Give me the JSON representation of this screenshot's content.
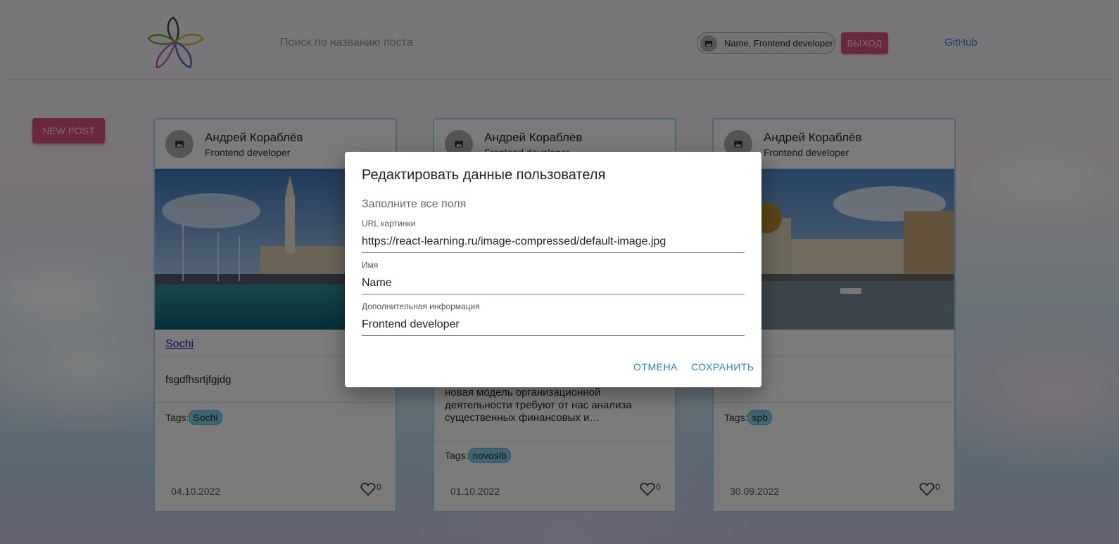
{
  "header": {
    "search_placeholder": "Поиск по названию поста",
    "user_chip": "Name, Frontend developer",
    "logout_label": "ВЫХОД",
    "github_label": "GitHub"
  },
  "new_post_label": "NEW POST",
  "posts": [
    {
      "author": "Андрей Кораблёв",
      "role": "Frontend developer",
      "title": "Sochi",
      "text": "fsgdfhsrtjfgjdg",
      "tags_label": "Tags:",
      "tag": "Sochi",
      "date": "04.10.2022",
      "likes": "0"
    },
    {
      "author": "Андрей Кораблёв",
      "role": "Frontend developer",
      "text": "новая модель организационной деятельности требуют от нас анализа существенных финансовых и…",
      "tags_label": "Tags:",
      "tag": "novosib",
      "date": "01.10.2022",
      "likes": "0"
    },
    {
      "author": "Андрей Кораблёв",
      "role": "Frontend developer",
      "tags_label": "Tags:",
      "tag": "spb",
      "date": "30.09.2022",
      "likes": "0"
    }
  ],
  "dialog": {
    "title": "Редактировать данные пользователя",
    "subtitle": "Заполните все поля",
    "fields": [
      {
        "label": "URL картинки",
        "value": "https://react-learning.ru/image-compressed/default-image.jpg"
      },
      {
        "label": "Имя",
        "value": "Name"
      },
      {
        "label": "Дополнительная информация",
        "value": "Frontend developer"
      }
    ],
    "cancel_label": "ОТМЕНА",
    "save_label": "СОХРАНИТЬ"
  },
  "colors": {
    "accent_pink": "#d3517f",
    "link_blue": "#3e78c4",
    "dialog_button_blue": "#2c7fcf",
    "tag_cyan": "#7ecbe2",
    "card_border": "#9fd3e6"
  },
  "icons": {
    "avatar": "image-placeholder-icon",
    "like": "heart-outline-icon",
    "logo": "flower-logo-icon"
  }
}
